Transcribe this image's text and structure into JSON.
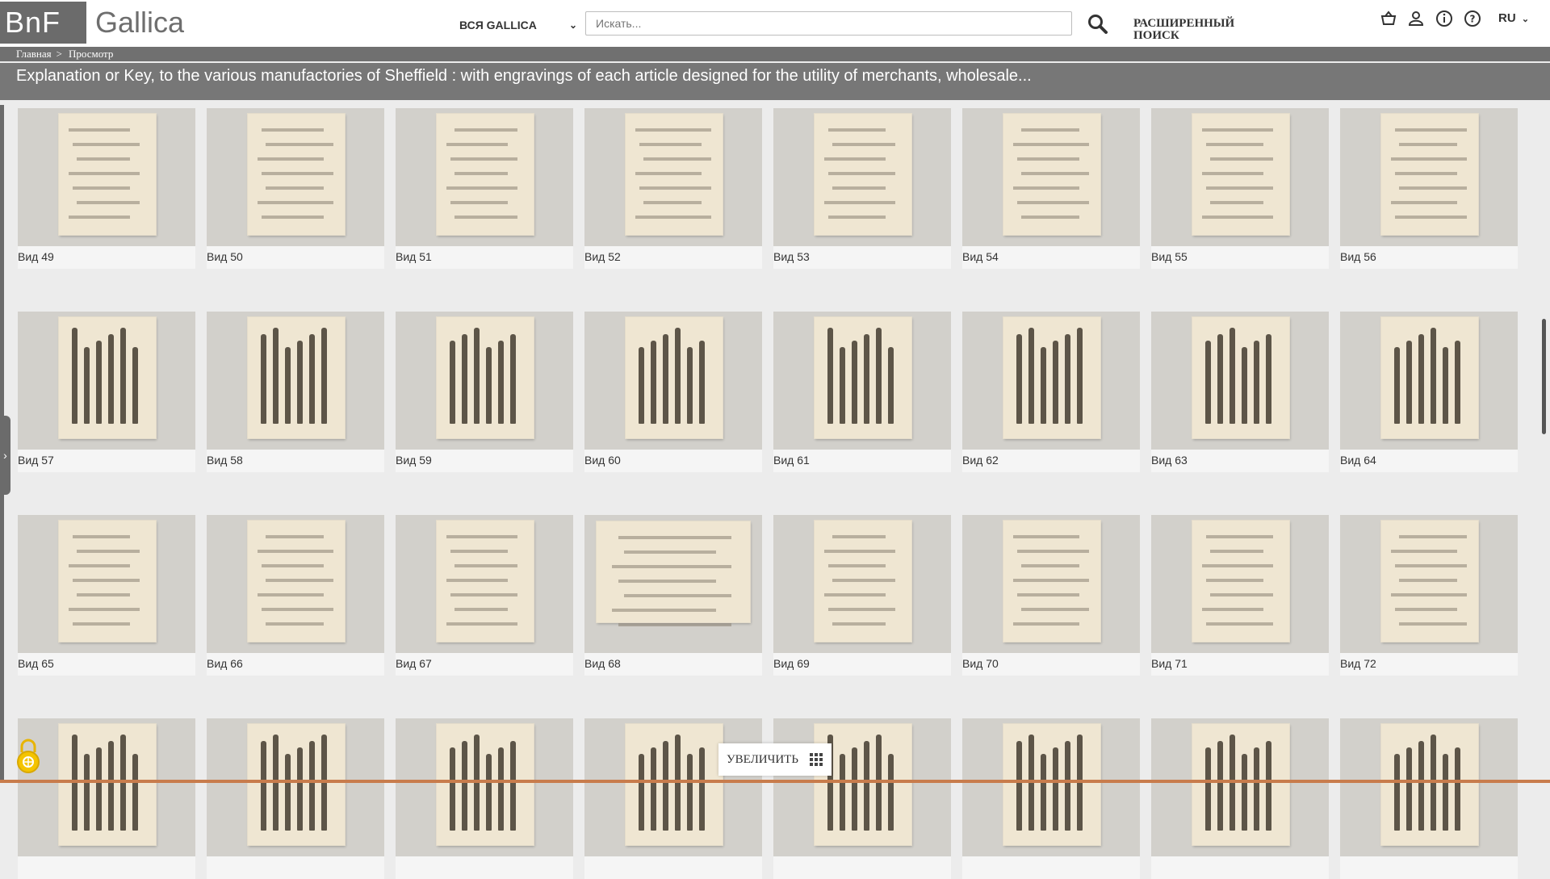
{
  "header": {
    "logo": "BnF",
    "site_name": "Gallica",
    "scope_label": "ВСЯ GALLICA",
    "search_placeholder": "Искать...",
    "advanced_search": "РАСШИРЕННЫЙ ПОИСК",
    "language": "RU"
  },
  "breadcrumb": {
    "home": "Главная",
    "separator": ">",
    "current": "Просмотр"
  },
  "document_title": "Explanation or Key, to the various manufactories of Sheffield : with engravings of each article designed for the utility of merchants, wholesale...",
  "thumbnails": [
    {
      "label": "Вид 49"
    },
    {
      "label": "Вид 50"
    },
    {
      "label": "Вид 51"
    },
    {
      "label": "Вид 52"
    },
    {
      "label": "Вид 53"
    },
    {
      "label": "Вид 54"
    },
    {
      "label": "Вид 55"
    },
    {
      "label": "Вид 56"
    },
    {
      "label": "Вид 57"
    },
    {
      "label": "Вид 58"
    },
    {
      "label": "Вид 59"
    },
    {
      "label": "Вид 60"
    },
    {
      "label": "Вид 61"
    },
    {
      "label": "Вид 62"
    },
    {
      "label": "Вид 63"
    },
    {
      "label": "Вид 64"
    },
    {
      "label": "Вид 65"
    },
    {
      "label": "Вид 66"
    },
    {
      "label": "Вид 67"
    },
    {
      "label": "Вид 68"
    },
    {
      "label": "Вид 69"
    },
    {
      "label": "Вид 70"
    },
    {
      "label": "Вид 71"
    },
    {
      "label": "Вид 72"
    },
    {
      "label": ""
    },
    {
      "label": ""
    },
    {
      "label": ""
    },
    {
      "label": ""
    },
    {
      "label": ""
    },
    {
      "label": ""
    },
    {
      "label": ""
    },
    {
      "label": ""
    }
  ],
  "zoom_label": "УВЕЛИЧИТЬ",
  "icons": {
    "search": "search-icon",
    "basket": "basket-icon",
    "account": "user-icon",
    "info": "info-icon",
    "help": "help-icon",
    "grid": "grid-icon",
    "lock": "lock-icon"
  },
  "colors": {
    "header_gray": "#6b6b6b",
    "title_bar": "#777777",
    "tile_bg": "#d2d0cb",
    "paper": "#efe6d2"
  }
}
